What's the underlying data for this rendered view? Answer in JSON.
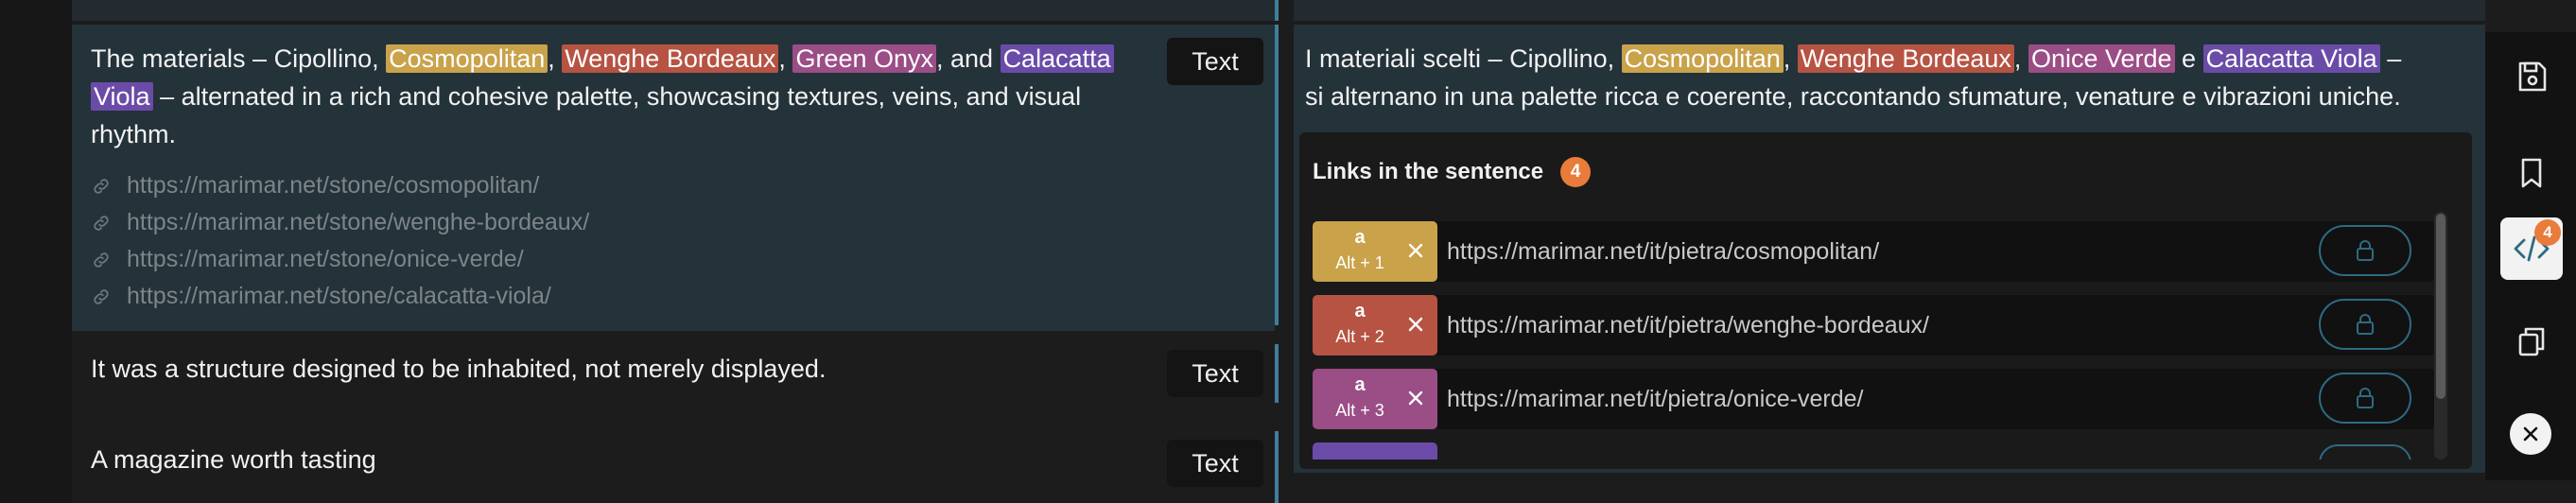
{
  "source_row1": {
    "pre": "The materials – Cipollino, ",
    "h1": "Cosmopolitan",
    "sep1": ", ",
    "h2": "Wenghe Bordeaux",
    "sep2": ", ",
    "h3": "Green Onyx",
    "sep3": ", and ",
    "h4a": "Calacatta",
    "h4b": "Viola",
    "post1": " – alternated in a rich and cohesive palette, showcasing textures, veins, and visual",
    "post2": "rhythm.",
    "links": [
      "https://marimar.net/stone/cosmopolitan/",
      "https://marimar.net/stone/wenghe-bordeaux/",
      "https://marimar.net/stone/onice-verde/",
      "https://marimar.net/stone/calacatta-viola/"
    ],
    "type_label": "Text"
  },
  "target_row1": {
    "pre": "I materiali scelti – Cipollino, ",
    "h1": "Cosmopolitan",
    "sep1": ", ",
    "h2": "Wenghe Bordeaux",
    "sep2": ", ",
    "h3": "Onice Verde",
    "sep3": " e ",
    "h4": "Calacatta Viola",
    "post1": " –",
    "post2": "si alternano in una palette ricca e coerente, raccontando sfumature, venature e vibrazioni uniche."
  },
  "links_panel": {
    "title": "Links in the sentence",
    "count": "4",
    "rows": [
      {
        "tag": "a",
        "shortcut": "Alt + 1",
        "url": "https://marimar.net/it/pietra/cosmopolitan/",
        "color": "#c9a24a"
      },
      {
        "tag": "a",
        "shortcut": "Alt + 2",
        "url": "https://marimar.net/it/pietra/wenghe-bordeaux/",
        "color": "#b65343"
      },
      {
        "tag": "a",
        "shortcut": "Alt + 3",
        "url": "https://marimar.net/it/pietra/onice-verde/",
        "color": "#9b4d86"
      }
    ],
    "partial_row_color": "#6a4ca8"
  },
  "source_row2": {
    "text": "It was a structure designed to be inhabited, not merely displayed.",
    "type_label": "Text"
  },
  "source_row3": {
    "text": "A magazine worth tasting",
    "type_label": "Text"
  },
  "toolbar": {
    "code_badge": "4",
    "icons": [
      "save-icon",
      "bookmark-icon",
      "code-icon",
      "copy-icon",
      "close-icon"
    ]
  },
  "colors": {
    "accent": "#3f7f9a",
    "badge": "#e97c3b"
  }
}
